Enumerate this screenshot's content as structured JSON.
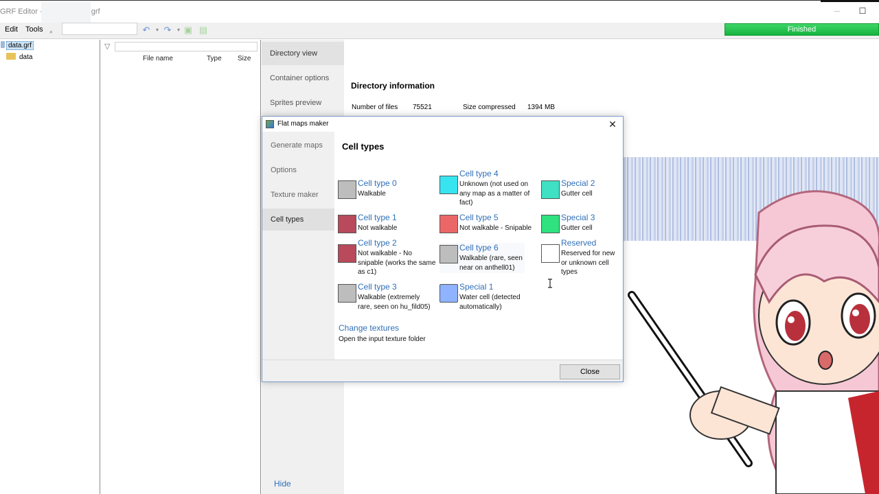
{
  "window": {
    "title_prefix": "GRF Editor - C",
    "title_suffix": "grf"
  },
  "menu": {
    "edit": "Edit",
    "tools": "Tools"
  },
  "toolbar": {
    "status": "Finished"
  },
  "tree": {
    "root": "data.grf",
    "child": "data"
  },
  "file_list": {
    "columns": [
      "File name",
      "Type",
      "Size"
    ]
  },
  "side_nav": {
    "items": [
      "Directory view",
      "Container options",
      "Sprites preview"
    ],
    "hide_label": "Hide"
  },
  "directory_info": {
    "heading": "Directory information",
    "files_label": "Number of files",
    "files_value": "75521",
    "size_label": "Size compressed",
    "size_value": "1394 MB"
  },
  "dialog": {
    "title": "Flat maps maker",
    "nav": [
      "Generate maps",
      "Options",
      "Texture maker",
      "Cell types"
    ],
    "heading": "Cell types",
    "close_label": "Close",
    "change_textures": "Change textures",
    "change_textures_desc": "Open the input texture folder",
    "cells": [
      {
        "title": "Cell type 0",
        "desc": "Walkable",
        "color": "#bdbdbd"
      },
      {
        "title": "Cell type 4",
        "desc": "Unknown (not used on any map as a matter of fact)",
        "color": "#37e4f0"
      },
      {
        "title": "Special 2",
        "desc": "Gutter cell",
        "color": "#3fe0c4"
      },
      {
        "title": "Cell type 1",
        "desc": "Not walkable",
        "color": "#b84a5c"
      },
      {
        "title": "Cell type 5",
        "desc": "Not walkable - Snipable",
        "color": "#eb6767"
      },
      {
        "title": "Special 3",
        "desc": "Gutter cell",
        "color": "#2fe27f"
      },
      {
        "title": "Cell type 2",
        "desc": "Not walkable - No snipable (works the same as c1)",
        "color": "#b84a5c"
      },
      {
        "title": "Cell type 6",
        "desc": "Walkable (rare, seen near on anthell01)",
        "color": "#bdbdbd"
      },
      {
        "title": "Reserved",
        "desc": "Reserved for new or unknown cell types",
        "color": "#ffffff"
      },
      {
        "title": "Cell type 3",
        "desc": "Walkable (extremely rare, seen on hu_fild05)",
        "color": "#bdbdbd"
      },
      {
        "title": "Special 1",
        "desc": "Water cell (detected automatically)",
        "color": "#8fb3ff"
      }
    ]
  }
}
